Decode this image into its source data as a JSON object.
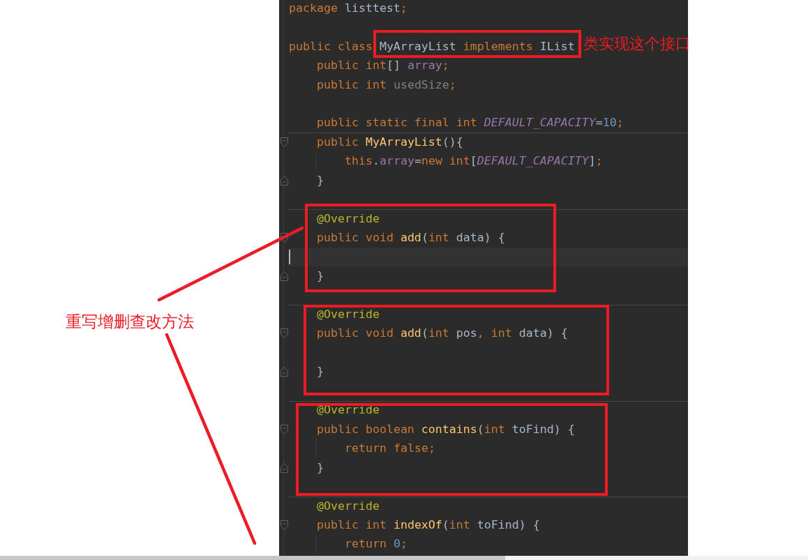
{
  "editor": {
    "lines": [
      {
        "kind": "code",
        "tokens": [
          {
            "kind": "keyword",
            "text": "package"
          },
          {
            "kind": "plain",
            "text": " listtest"
          },
          {
            "kind": "punct",
            "text": ";"
          }
        ]
      },
      {
        "kind": "blank"
      },
      {
        "kind": "code",
        "parts": [
          {
            "tokens": [
              {
                "kind": "keyword",
                "text": "public class"
              }
            ]
          },
          {
            "tokens": [
              {
                "kind": "plain",
                "text": "MyArrayList "
              },
              {
                "kind": "keyword",
                "text": "implements "
              },
              {
                "kind": "plain",
                "text": "IList"
              }
            ]
          }
        ],
        "children": [
          {
            "kind": "code",
            "tokens": [
              {
                "kind": "keyword",
                "text": "public int"
              },
              {
                "kind": "plain",
                "text": "[] "
              },
              {
                "kind": "field",
                "text": "array"
              },
              {
                "kind": "punct",
                "text": ";"
              }
            ]
          },
          {
            "kind": "code",
            "tokens": [
              {
                "kind": "keyword",
                "text": "public int "
              },
              {
                "kind": "unused",
                "text": "usedSize"
              },
              {
                "kind": "punct",
                "text": ";"
              }
            ]
          },
          {
            "kind": "blank"
          },
          {
            "kind": "code",
            "tokens": [
              {
                "kind": "keyword",
                "text": "public static final int "
              },
              {
                "kind": "constant",
                "text": "DEFAULT_CAPACITY"
              },
              {
                "kind": "plain",
                "text": "="
              },
              {
                "kind": "number",
                "text": "10"
              },
              {
                "kind": "punct",
                "text": ";"
              }
            ]
          },
          {
            "kind": "separator"
          },
          {
            "kind": "code",
            "gutter_mark": {
              "kind": "fold_start"
            },
            "tokens": [
              {
                "kind": "keyword",
                "text": "public "
              },
              {
                "kind": "method",
                "text": "MyArrayList"
              },
              {
                "kind": "plain",
                "text": "(){"
              }
            ],
            "children": [
              {
                "kind": "code",
                "tokens": [
                  {
                    "kind": "keyword",
                    "text": "this"
                  },
                  {
                    "kind": "plain",
                    "text": "."
                  },
                  {
                    "kind": "field",
                    "text": "array"
                  },
                  {
                    "kind": "plain",
                    "text": "="
                  },
                  {
                    "kind": "keyword",
                    "text": "new int"
                  },
                  {
                    "kind": "plain",
                    "text": "["
                  },
                  {
                    "kind": "constant",
                    "text": "DEFAULT_CAPACITY"
                  },
                  {
                    "kind": "plain",
                    "text": "]"
                  },
                  {
                    "kind": "punct",
                    "text": ";"
                  }
                ]
              }
            ]
          },
          {
            "kind": "code",
            "gutter_mark": {
              "kind": "fold_end"
            },
            "tokens": [
              {
                "kind": "plain",
                "text": "}"
              }
            ]
          },
          {
            "kind": "blank"
          },
          {
            "kind": "separator"
          },
          {
            "kind": "code",
            "tokens": [
              {
                "kind": "annotation",
                "text": "@Override"
              }
            ]
          },
          {
            "kind": "code",
            "gutter_mark": {
              "kind": "fold_start"
            },
            "tokens": [
              {
                "kind": "keyword",
                "text": "public void "
              },
              {
                "kind": "method",
                "text": "add"
              },
              {
                "kind": "plain",
                "text": "("
              },
              {
                "kind": "keyword",
                "text": "int "
              },
              {
                "kind": "plain",
                "text": "data) {"
              }
            ],
            "children": [
              {
                "kind": "cursor"
              }
            ]
          },
          {
            "kind": "code",
            "gutter_mark": {
              "kind": "fold_end"
            },
            "tokens": [
              {
                "kind": "plain",
                "text": "}"
              }
            ]
          },
          {
            "kind": "blank"
          },
          {
            "kind": "separator"
          },
          {
            "kind": "code",
            "tokens": [
              {
                "kind": "annotation",
                "text": "@Override"
              }
            ]
          },
          {
            "kind": "code",
            "gutter_mark": {
              "kind": "fold_start"
            },
            "tokens": [
              {
                "kind": "keyword",
                "text": "public void "
              },
              {
                "kind": "method",
                "text": "add"
              },
              {
                "kind": "plain",
                "text": "("
              },
              {
                "kind": "keyword",
                "text": "int "
              },
              {
                "kind": "plain",
                "text": "pos"
              },
              {
                "kind": "punct",
                "text": ","
              },
              {
                "kind": "keyword",
                "text": " int "
              },
              {
                "kind": "plain",
                "text": "data) {"
              }
            ],
            "children": [
              {
                "kind": "blank"
              }
            ]
          },
          {
            "kind": "code",
            "gutter_mark": {
              "kind": "fold_end"
            },
            "tokens": [
              {
                "kind": "plain",
                "text": "}"
              }
            ]
          },
          {
            "kind": "blank"
          },
          {
            "kind": "separator"
          },
          {
            "kind": "code",
            "tokens": [
              {
                "kind": "annotation",
                "text": "@Override"
              }
            ]
          },
          {
            "kind": "code",
            "gutter_mark": {
              "kind": "fold_start"
            },
            "tokens": [
              {
                "kind": "keyword",
                "text": "public boolean "
              },
              {
                "kind": "method",
                "text": "contains"
              },
              {
                "kind": "plain",
                "text": "("
              },
              {
                "kind": "keyword",
                "text": "int "
              },
              {
                "kind": "plain",
                "text": "toFind) {"
              }
            ],
            "children": [
              {
                "kind": "code",
                "tokens": [
                  {
                    "kind": "keyword",
                    "text": "return false"
                  },
                  {
                    "kind": "punct",
                    "text": ";"
                  }
                ]
              }
            ]
          },
          {
            "kind": "code",
            "gutter_mark": {
              "kind": "fold_end"
            },
            "tokens": [
              {
                "kind": "plain",
                "text": "}"
              }
            ]
          },
          {
            "kind": "blank"
          },
          {
            "kind": "separator"
          },
          {
            "kind": "code",
            "tokens": [
              {
                "kind": "annotation",
                "text": "@Override"
              }
            ]
          },
          {
            "kind": "code",
            "gutter_mark": {
              "kind": "fold_start"
            },
            "tokens": [
              {
                "kind": "keyword",
                "text": "public int "
              },
              {
                "kind": "method",
                "text": "indexOf"
              },
              {
                "kind": "plain",
                "text": "("
              },
              {
                "kind": "keyword",
                "text": "int "
              },
              {
                "kind": "plain",
                "text": "toFind) {"
              }
            ],
            "children": [
              {
                "kind": "code",
                "tokens": [
                  {
                    "kind": "keyword",
                    "text": "return "
                  },
                  {
                    "kind": "number",
                    "text": "0"
                  },
                  {
                    "kind": "punct",
                    "text": ";"
                  }
                ]
              }
            ]
          }
        ]
      }
    ]
  },
  "annotations": [
    {
      "kind": "frame"
    },
    {
      "kind": "note",
      "text": "类实现这个接口"
    },
    {
      "kind": "frame"
    },
    {
      "kind": "frame"
    },
    {
      "kind": "frame"
    },
    {
      "kind": "note",
      "text": "重写增删查改方法"
    },
    {
      "kind": "leader"
    },
    {
      "kind": "leader"
    }
  ]
}
